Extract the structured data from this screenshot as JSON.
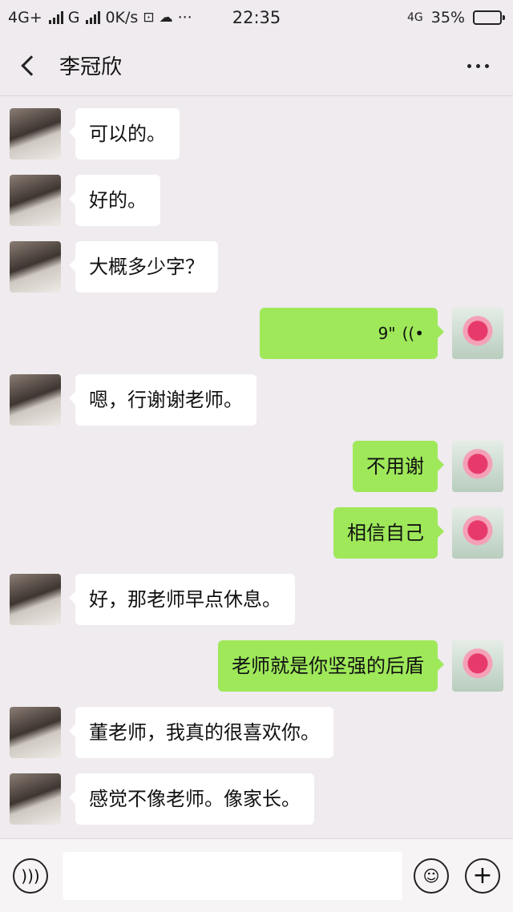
{
  "status_bar": {
    "left": "4G+",
    "network2": "G",
    "speed": "0K/s",
    "sim_icon": "sim-card-icon",
    "cloud_icon": "cloud-icon",
    "more": "···",
    "time": "22:35",
    "lte": "4G",
    "battery_pct": "35%",
    "battery_level": 0.35
  },
  "header": {
    "title": "李冠欣"
  },
  "messages": [
    {
      "side": "in",
      "text": "可以的。"
    },
    {
      "side": "in",
      "text": "好的。"
    },
    {
      "side": "in",
      "text": "大概多少字？"
    },
    {
      "side": "out",
      "type": "voice",
      "text": "9\"",
      "icon": "voice-wave-icon"
    },
    {
      "side": "in",
      "text": "嗯，行谢谢老师。"
    },
    {
      "side": "out",
      "text": "不用谢"
    },
    {
      "side": "out",
      "text": "相信自己"
    },
    {
      "side": "in",
      "text": "好，那老师早点休息。"
    },
    {
      "side": "out",
      "text": "老师就是你坚强的后盾"
    },
    {
      "side": "in",
      "text": "董老师，我真的很喜欢你。"
    },
    {
      "side": "in",
      "text": "感觉不像老师。像家长。"
    }
  ],
  "input_bar": {
    "voice_icon": "voice-input-icon",
    "emoji_icon": "emoji-icon",
    "plus_icon": "plus-icon"
  },
  "colors": {
    "background": "#efebee",
    "incoming_bubble": "#ffffff",
    "outgoing_bubble": "#9ee85a"
  }
}
